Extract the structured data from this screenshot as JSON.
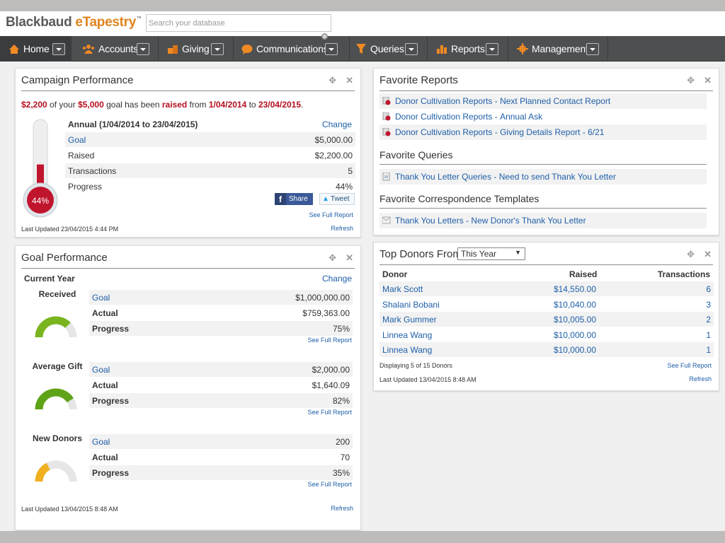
{
  "app": {
    "brand_part1": "Blackbaud",
    "brand_part2": "eTapestry",
    "brand_tm": "™"
  },
  "search": {
    "placeholder": "Search your database"
  },
  "nav": [
    {
      "label": "Home",
      "icon": "house-icon"
    },
    {
      "label": "Accounts",
      "icon": "people-icon"
    },
    {
      "label": "Giving",
      "icon": "coins-icon"
    },
    {
      "label": "Communications",
      "icon": "speech-bubble-icon"
    },
    {
      "label": "Queries",
      "icon": "funnel-icon"
    },
    {
      "label": "Reports",
      "icon": "bar-chart-icon"
    },
    {
      "label": "Management",
      "icon": "gear-icon"
    }
  ],
  "campaign": {
    "title": "Campaign Performance",
    "raised": "$2,200",
    "goal": "$5,000",
    "text1": " of your ",
    "text2": " goal has been ",
    "raised_word": "raised",
    "text3": " from ",
    "from": "1/04/2014",
    "text4": " to ",
    "to": "23/04/2015",
    "period_end": ".",
    "thermo_pct": "44%",
    "thermo_fill": 0.44,
    "heading": "Annual (1/04/2014 to 23/04/2015)",
    "change": "Change",
    "rows": [
      {
        "label": "Goal",
        "value": "$5,000.00",
        "link": true
      },
      {
        "label": "Raised",
        "value": "$2,200.00",
        "link": false
      },
      {
        "label": "Transactions",
        "value": "5",
        "link": false
      },
      {
        "label": "Progress",
        "value": "44%",
        "link": false
      }
    ],
    "share": "Share",
    "tweet": "Tweet",
    "see_full": "See Full Report",
    "updated": "Last Updated 23/04/2015 4:44 PM",
    "refresh": "Refresh"
  },
  "goal": {
    "title": "Goal Performance",
    "subtitle": "Current Year",
    "change": "Change",
    "sections": [
      {
        "name": "Received",
        "rows": [
          [
            "Goal",
            "$1,000,000.00"
          ],
          [
            "Actual",
            "$759,363.00"
          ],
          [
            "Progress",
            "75%"
          ]
        ],
        "pct": 0.75,
        "color": "#7ab520"
      },
      {
        "name": "Average Gift",
        "rows": [
          [
            "Goal",
            "$2,000.00"
          ],
          [
            "Actual",
            "$1,640.09"
          ],
          [
            "Progress",
            "82%"
          ]
        ],
        "pct": 0.82,
        "color": "#5fa318"
      },
      {
        "name": "New Donors",
        "rows": [
          [
            "Goal",
            "200"
          ],
          [
            "Actual",
            "70"
          ],
          [
            "Progress",
            "35%"
          ]
        ],
        "pct": 0.35,
        "color": "#f0b020"
      }
    ],
    "see_full": "See Full Report",
    "updated": "Last Updated 13/04/2015 8:48 AM",
    "refresh": "Refresh"
  },
  "favorites": {
    "title": "Favorite Reports",
    "reports": [
      {
        "cat": "Donor Cultivation Reports",
        "name": "Next Planned Contact Report"
      },
      {
        "cat": "Donor Cultivation Reports",
        "name": "Annual Ask"
      },
      {
        "cat": "Donor Cultivation Reports",
        "name": "Giving Details Report - 6/21"
      }
    ],
    "queries_title": "Favorite Queries",
    "queries": [
      {
        "cat": "Thank You Letter Queries",
        "name": "Need to send Thank You Letter"
      }
    ],
    "templates_title": "Favorite Correspondence Templates",
    "templates": [
      {
        "cat": "Thank You Letters",
        "name": "New Donor's Thank You Letter"
      }
    ],
    "sep": " - "
  },
  "donors": {
    "title": "Top Donors From",
    "period": "This Year",
    "col_donor": "Donor",
    "col_raised": "Raised",
    "col_tx": "Transactions",
    "rows": [
      [
        "Mark Scott",
        "$14,550.00",
        "6"
      ],
      [
        "Shalani Bobani",
        "$10,040.00",
        "3"
      ],
      [
        "Mark Gummer",
        "$10,005.00",
        "2"
      ],
      [
        "Linnea Wang",
        "$10,000.00",
        "1"
      ],
      [
        "Linnea Wang",
        "$10,000.00",
        "1"
      ]
    ],
    "displaying": "Displaying 5 of 15 Donors",
    "see_full": "See Full Report",
    "updated": "Last Updated 13/04/2015 8:48 AM",
    "refresh": "Refresh"
  },
  "colors": {
    "nav_bg": "#4e4f51",
    "brand_orange": "#e0841e",
    "link": "#1f5fa8",
    "red": "#b50f1e"
  }
}
